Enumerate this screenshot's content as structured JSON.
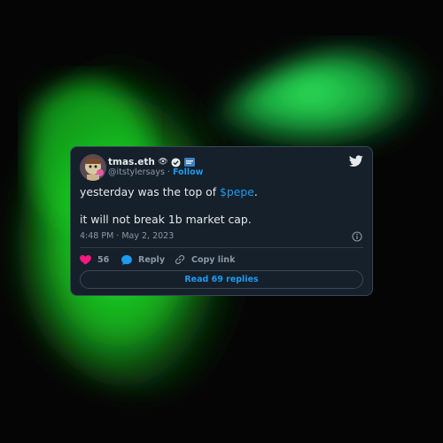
{
  "tweet": {
    "display_name": "tmas.eth",
    "name_emoji": "👁",
    "badge_icons": [
      "verified-badge-icon",
      "flag-emoji-icon"
    ],
    "handle": "@itstylersays",
    "separator": "·",
    "follow_label": "Follow",
    "text_line1_prefix": "yesterday was the top of ",
    "cashtag": "$pepe",
    "text_line1_suffix": ".",
    "text_line2": "it will not break 1b market cap.",
    "timestamp": "4:48 PM · May 2, 2023",
    "likes_count": "56",
    "reply_label": "Reply",
    "copy_link_label": "Copy link",
    "read_replies_label": "Read 69 replies"
  },
  "colors": {
    "accent": "#1d9bf0",
    "card_bg": "#15202b",
    "heart": "#f91880",
    "green": "#22c55e"
  }
}
